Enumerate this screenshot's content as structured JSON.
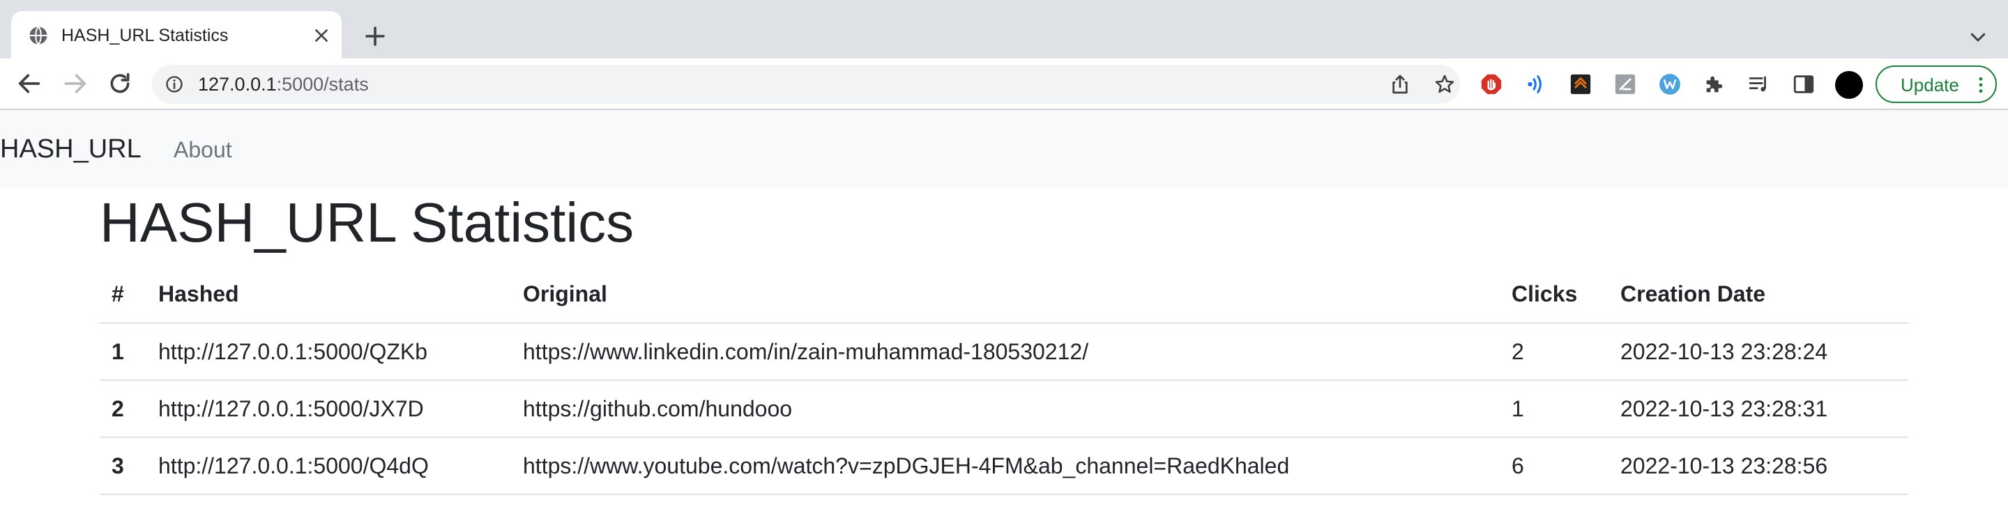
{
  "browser": {
    "tab": {
      "title": "HASH_URL Statistics"
    },
    "address_bar": {
      "host": "127.0.0.1",
      "path": ":5000/stats"
    },
    "update_label": "Update",
    "extensions": [
      "stop-hand-icon",
      "sound-wave-icon",
      "chevron-app-icon",
      "edit-page-icon",
      "w-circle-icon",
      "puzzle-icon",
      "playlist-icon",
      "side-panel-icon"
    ]
  },
  "navbar": {
    "brand": "HASH_URL",
    "links": [
      {
        "label": "About"
      }
    ]
  },
  "main": {
    "title": "HASH_URL Statistics",
    "table": {
      "headers": [
        "#",
        "Hashed",
        "Original",
        "Clicks",
        "Creation Date"
      ],
      "rows": [
        {
          "num": "1",
          "hashed": "http://127.0.0.1:5000/QZKb",
          "original": "https://www.linkedin.com/in/zain-muhammad-180530212/",
          "clicks": "2",
          "created": "2022-10-13 23:28:24"
        },
        {
          "num": "2",
          "hashed": "http://127.0.0.1:5000/JX7D",
          "original": "https://github.com/hundooo",
          "clicks": "1",
          "created": "2022-10-13 23:28:31"
        },
        {
          "num": "3",
          "hashed": "http://127.0.0.1:5000/Q4dQ",
          "original": "https://www.youtube.com/watch?v=zpDGJEH-4FM&ab_channel=RaedKhaled",
          "clicks": "6",
          "created": "2022-10-13 23:28:56"
        }
      ]
    }
  },
  "colors": {
    "tabstrip": "#dee1e6",
    "navbar_bg": "#f8f9fa",
    "text": "#212529",
    "muted": "#6c757d",
    "update_green": "#188038"
  }
}
